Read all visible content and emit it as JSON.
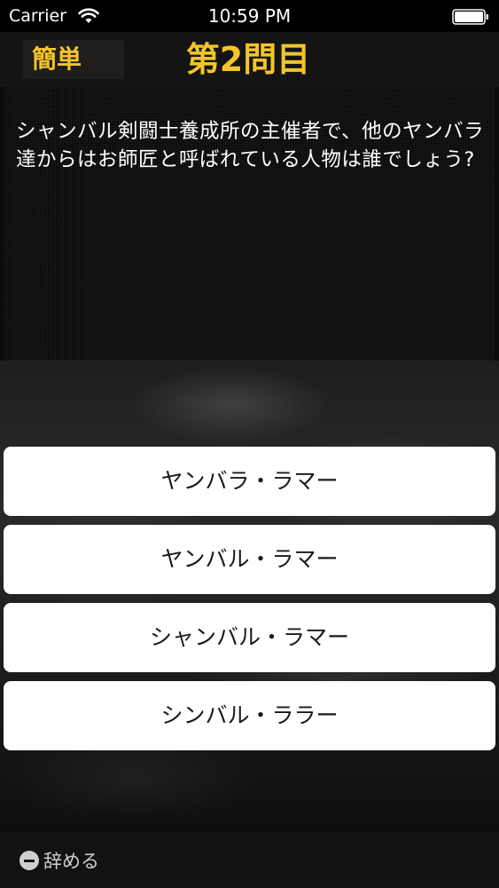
{
  "status_bar": {
    "carrier": "Carrier",
    "time": "10:59 PM",
    "icons": [
      "wifi-icon",
      "battery-icon"
    ]
  },
  "header": {
    "difficulty": "簡単",
    "question_number": "第2問目",
    "accent_color": "#f3c52b"
  },
  "question": {
    "text": "シャンバル剣闘士養成所の主催者で、他のヤンバラ達からはお師匠と呼ばれている人物は誰でしょう?"
  },
  "answers": [
    "ヤンバラ・ラマー",
    "ヤンバル・ラマー",
    "シャンバル・ラマー",
    "シンバル・ララー"
  ],
  "toolbar": {
    "quit_label": "辞める",
    "quit_icon": "minus-circle-icon"
  }
}
